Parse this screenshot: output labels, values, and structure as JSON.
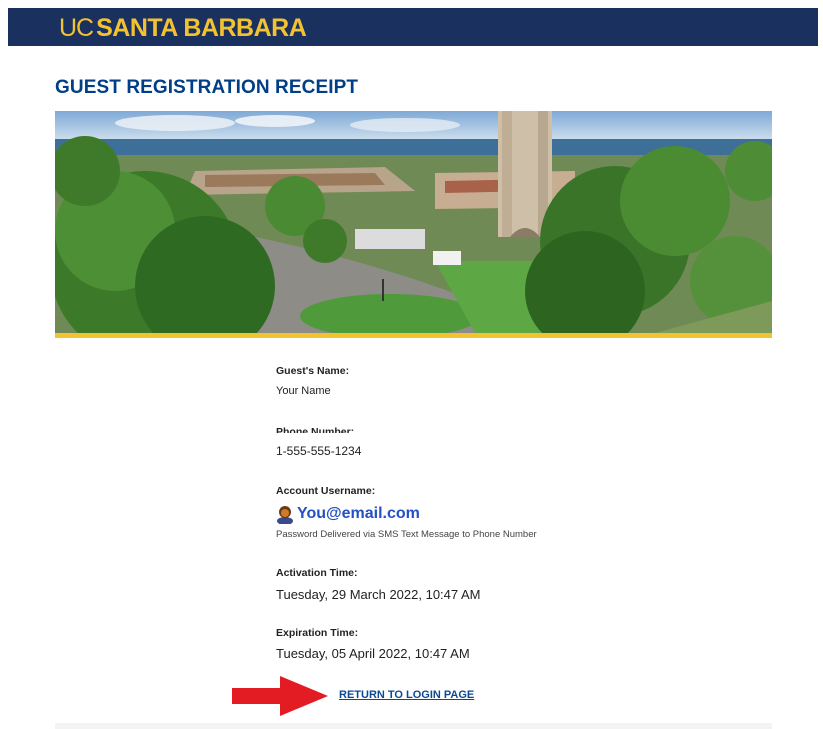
{
  "header": {
    "brand_prefix": "UC",
    "brand_name": "SANTA BARBARA"
  },
  "page": {
    "title": "GUEST REGISTRATION RECEIPT"
  },
  "receipt": {
    "guest_name_label": "Guest's Name:",
    "guest_name_value": "Your Name",
    "phone_label": "Phone Number:",
    "phone_value": "1-555-555-1234",
    "username_label": "Account Username:",
    "username_value": "You@email.com",
    "password_note": "Password Delivered via SMS Text Message to Phone Number",
    "activation_label": "Activation Time:",
    "activation_value": "Tuesday, 29 March 2022, 10:47 AM",
    "expiration_label": "Expiration Time:",
    "expiration_value": "Tuesday, 05 April 2022, 10:47 AM"
  },
  "actions": {
    "return_link_label": "RETURN TO LOGIN PAGE"
  },
  "icons": {
    "hero": "campus-photo",
    "avatar": "person-avatar-icon",
    "arrow": "red-arrow-icon"
  },
  "colors": {
    "navy": "#1a3160",
    "gold": "#f2c231",
    "title_blue": "#003f87",
    "link_blue": "#0b4a93",
    "username_blue": "#2450c7",
    "arrow_red": "#e31b23"
  }
}
